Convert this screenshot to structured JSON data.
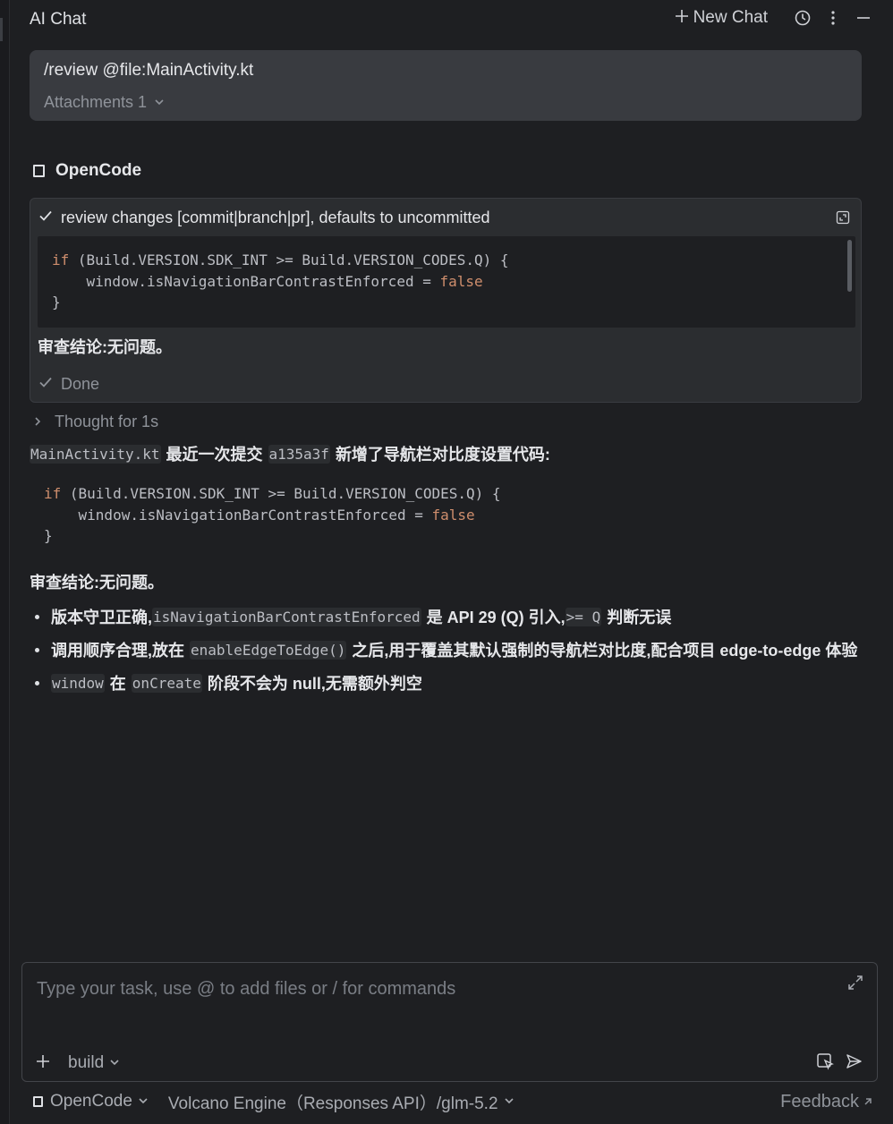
{
  "header": {
    "title": "AI Chat",
    "new_chat_label": "New Chat",
    "icons": [
      "plus-icon",
      "history-icon",
      "more-vertical-icon",
      "minimize-icon"
    ]
  },
  "prompt": {
    "text": "/review @file:MainActivity.kt",
    "attachments_label": "Attachments 1"
  },
  "agent": {
    "name": "OpenCode"
  },
  "tool_call": {
    "title": "review changes [commit|branch|pr], defaults to uncommitted",
    "code": {
      "line1_kw": "if",
      "line1_rest": " (Build.VERSION.SDK_INT >= Build.VERSION_CODES.Q) {",
      "line2_pre": "    window.isNavigationBarContrastEnforced = ",
      "line2_kw": "false",
      "line3": "}"
    },
    "verdict": "审查结论:无问题。",
    "status": "Done"
  },
  "thought_label": "Thought for 1s",
  "response": {
    "intro_code1": "MainActivity.kt",
    "intro_text1": "最近一次提交",
    "intro_code2": "a135a3f",
    "intro_text2": "新增了导航栏对比度设置代码:",
    "verdict": "审查结论:无问题。",
    "bullets": [
      {
        "t1": "版本守卫正确,",
        "c1": "isNavigationBarContrastEnforced",
        "t2": "是 API 29 (Q) 引入,",
        "c2": ">= Q",
        "t3": "判断无误"
      },
      {
        "t1": "调用顺序合理,放在",
        "c1": "enableEdgeToEdge()",
        "t2": "之后,用于覆盖其默认强制的导航栏对比度,配合项目 edge-to-edge 体验"
      },
      {
        "c1": "window",
        "t1": "在",
        "c2": "onCreate",
        "t2": "阶段不会为 null,无需额外判空"
      }
    ]
  },
  "input": {
    "placeholder": "Type your task, use @ to add files or / for commands",
    "mode": "build"
  },
  "footer": {
    "agent": "OpenCode",
    "model": "Volcano Engine（Responses API）/glm-5.2",
    "feedback": "Feedback"
  },
  "colors": {
    "background": "#1e1f22",
    "card": "#2b2d30",
    "prompt_bg": "#393b40",
    "keyword": "#cf8e6d",
    "text": "#dfe1e5",
    "muted": "#8f939a"
  }
}
